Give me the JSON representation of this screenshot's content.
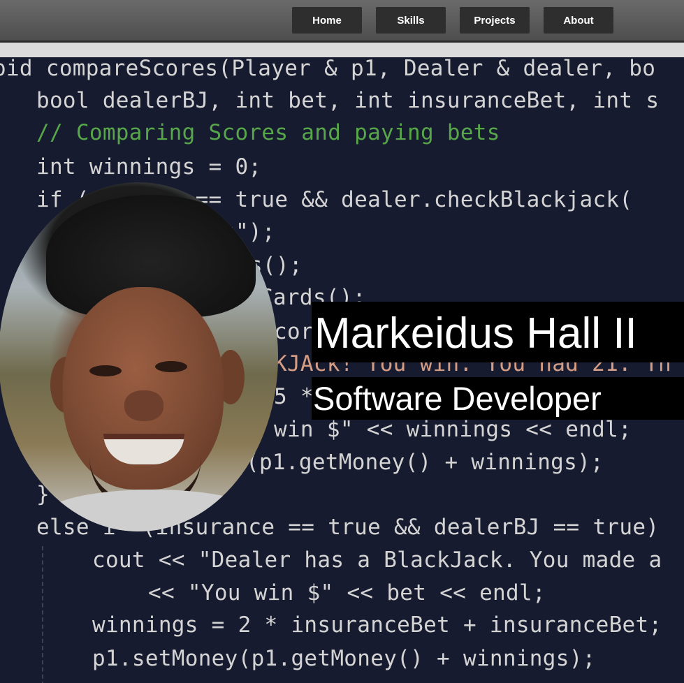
{
  "nav": {
    "items": [
      {
        "label": "Home"
      },
      {
        "label": "Skills"
      },
      {
        "label": "Projects"
      },
      {
        "label": "About"
      }
    ]
  },
  "hero": {
    "name": "Markeidus Hall II",
    "title": "Software Developer"
  },
  "code_lines": [
    "oid compareScores(Player & p1, Dealer & dealer, bo",
    "bool dealerBJ, int bet, int insuranceBet, int s",
    "// Comparing Scores and paying bets",
    "int winnings = 0;",
    "if (     ck == true && dealer.checkBlackjack(",
    "s\");",
    "ds();",
    "Cards();",
    "cor",
    "KJAck! You win. You had 21. Th",
    "5 *",
    "win $\" << winnings << endl;",
    "(p1.getMoney() + winnings);",
    "}",
    "else i  (insurance == true && dealerBJ == true)",
    "cout << \"Dealer has a BlackJack. You made a",
    "<< \"You win $\" << bet << endl;",
    "winnings = 2 * insuranceBet + insuranceBet;",
    "p1.setMoney(p1.getMoney() + winnings);"
  ],
  "colors": {
    "nav_bg": "#5a5a5a",
    "nav_button_bg": "#2e2e2e",
    "code_bg": "#171b2f",
    "banner_bg": "#000000",
    "banner_text": "#ffffff"
  },
  "icons": {
    "portrait": "profile-photo"
  }
}
